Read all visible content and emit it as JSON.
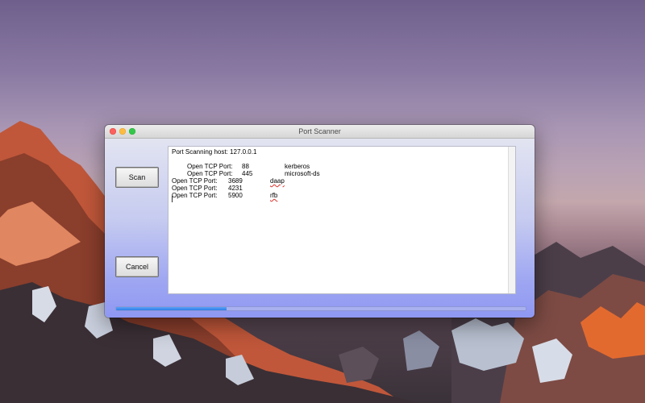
{
  "window": {
    "title": "Port Scanner"
  },
  "buttons": {
    "scan_label": "Scan",
    "cancel_label": "Cancel"
  },
  "output": {
    "header": "Port Scanning host: 127.0.0.1",
    "results": [
      {
        "label": "Open TCP Port:",
        "port": "88",
        "service": "kerberos",
        "indented": true,
        "misspelled": false
      },
      {
        "label": "Open TCP Port:",
        "port": "445",
        "service": "microsoft-ds",
        "indented": true,
        "misspelled": false
      },
      {
        "label": "Open TCP Port:",
        "port": "3689",
        "service": "daap",
        "indented": false,
        "misspelled": true
      },
      {
        "label": "Open TCP Port:",
        "port": "4231",
        "service": "",
        "indented": false,
        "misspelled": false
      },
      {
        "label": "Open TCP Port:",
        "port": "5900",
        "service": "rfb",
        "indented": false,
        "misspelled": true
      }
    ]
  },
  "progress": {
    "value": 0.27
  },
  "colors": {
    "accent": "#2f7fe9",
    "close": "#fc605c",
    "minimize": "#fdbc40",
    "maximize": "#34c84a"
  }
}
